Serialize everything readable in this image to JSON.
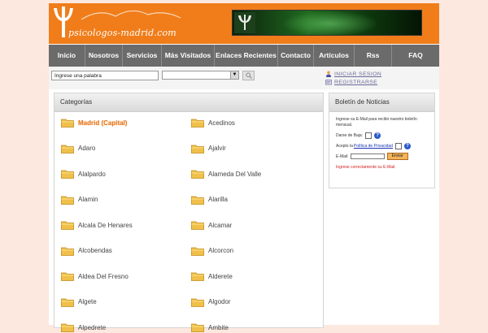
{
  "header": {
    "logo_text": "psicologos-madrid.com",
    "colors": {
      "brand": "#f07d1a",
      "nav": "#6b6b6b",
      "active_category": "#e8731a"
    }
  },
  "nav": {
    "items": [
      {
        "label": "Inicio"
      },
      {
        "label": "Nosotros"
      },
      {
        "label": "Servicios"
      },
      {
        "label": "Más Visitados"
      },
      {
        "label": "Enlaces Recientes"
      },
      {
        "label": "Contacto"
      },
      {
        "label": "Artículos"
      },
      {
        "label": "Rss"
      },
      {
        "label": "FAQ"
      }
    ]
  },
  "search": {
    "input_value": "Ingrese una palabra",
    "select_value": "",
    "button_icon": "search-icon"
  },
  "user": {
    "login_label": "INICIAR SESION",
    "register_label": "REGISTRARSE"
  },
  "categories": {
    "title": "Categorías",
    "left": [
      "Madrid (Capital)",
      "Adaro",
      "Alalpardo",
      "Alamin",
      "Alcala De Henares",
      "Alcobendas",
      "Aldea Del Fresno",
      "Algete",
      "Alpedrete"
    ],
    "right": [
      "Acedinos",
      "Ajalvir",
      "Alameda Del Valle",
      "Alarilla",
      "Alcamar",
      "Alcorcon",
      "Alderete",
      "Algodor",
      "Ambite"
    ]
  },
  "newsletter": {
    "title": "Boletín de Noticias",
    "description": "Ingrese su E-Mail para recibir nuestro boletín mensual.",
    "unsubscribe_label": "Darse de Baja:",
    "accept_prefix": "Acepto la",
    "privacy_link": "Política de Privacidad",
    "email_label": "E-Mail:",
    "send_label": "Enviar",
    "success_message": "Ingrese correctamente su E-Mail."
  }
}
